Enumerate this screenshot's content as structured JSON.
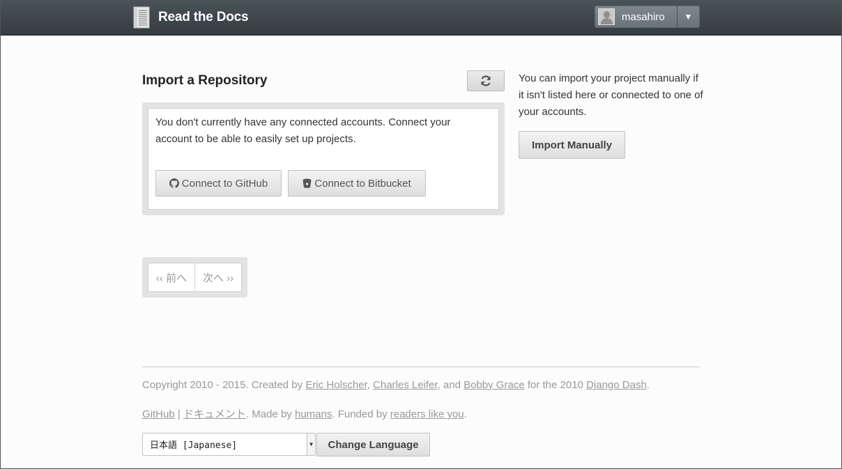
{
  "header": {
    "brand": "Read the Docs",
    "user": {
      "name": "masahiro",
      "menu_caret": "▼"
    },
    "logo_icon": "book-icon",
    "avatar_icon": "user-avatar-icon"
  },
  "import": {
    "title": "Import a Repository",
    "refresh_icon": "refresh-icon",
    "message": "You don't currently have any connected accounts. Connect your account to be able to easily set up projects.",
    "connect_github": "Connect to GitHub",
    "connect_bitbucket": "Connect to Bitbucket"
  },
  "side": {
    "help": "You can import your project manually if it isn't listed here or connected to one of your accounts.",
    "import_manually": "Import Manually"
  },
  "pagination": {
    "prev": "‹‹ 前へ",
    "next": "次へ ››"
  },
  "footer": {
    "copyright_prefix": "Copyright 2010 - 2015. Created by ",
    "author1": "Eric Holscher",
    "sep1": ", ",
    "author2": "Charles Leifer",
    "sep2": ", and ",
    "author3": "Bobby Grace",
    "mid": " for the 2010 ",
    "django_dash": "Django Dash",
    "end": ".",
    "github": "GitHub",
    "pipe": " | ",
    "docs": "ドキュメント",
    "made_by": ". Made by ",
    "humans": "humans",
    "funded_by": ". Funded by ",
    "readers": "readers like you",
    "end2": "."
  },
  "language": {
    "selected": "日本語 [Japanese]",
    "button": "Change Language"
  },
  "colors": {
    "header_bg": "#3d464b",
    "page_bg": "#fcfcfc",
    "well_bg": "#e3e3e3"
  }
}
